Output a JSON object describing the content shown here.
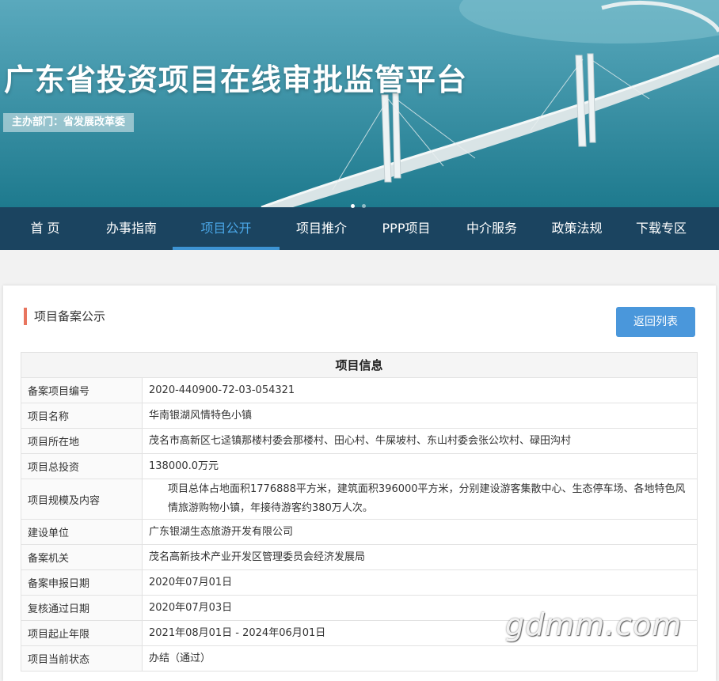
{
  "header": {
    "site_title": "广东省投资项目在线审批监管平台",
    "sponsor": "主办部门：省发展改革委"
  },
  "nav": {
    "items": [
      {
        "label": "首 页",
        "active": false
      },
      {
        "label": "办事指南",
        "active": false
      },
      {
        "label": "项目公开",
        "active": true
      },
      {
        "label": "项目推介",
        "active": false
      },
      {
        "label": "PPP项目",
        "active": false
      },
      {
        "label": "中介服务",
        "active": false
      },
      {
        "label": "政策法规",
        "active": false
      },
      {
        "label": "下载专区",
        "active": false
      }
    ]
  },
  "panel": {
    "heading": "项目备案公示",
    "back_button": "返回列表",
    "table_title": "项目信息",
    "rows": [
      {
        "label": "备案项目编号",
        "value": "2020-440900-72-03-054321"
      },
      {
        "label": "项目名称",
        "value": "华南银湖风情特色小镇"
      },
      {
        "label": "项目所在地",
        "value": "茂名市高新区七迳镇那楼村委会那楼村、田心村、牛屎坡村、东山村委会张公坎村、碌田沟村"
      },
      {
        "label": "项目总投资",
        "value": "138000.0万元"
      },
      {
        "label": "项目规模及内容",
        "value": "项目总体占地面积1776888平方米，建筑面积396000平方米，分别建设游客集散中心、生态停车场、各地特色风情旅游购物小镇，年接待游客约380万人次。"
      },
      {
        "label": "建设单位",
        "value": "广东银湖生态旅游开发有限公司"
      },
      {
        "label": "备案机关",
        "value": "茂名高新技术产业开发区管理委员会经济发展局"
      },
      {
        "label": "备案申报日期",
        "value": "2020年07月01日"
      },
      {
        "label": "复核通过日期",
        "value": "2020年07月03日"
      },
      {
        "label": "项目起止年限",
        "value": "2021年08月01日 - 2024年06月01日"
      },
      {
        "label": "项目当前状态",
        "value": "办结（通过）"
      }
    ]
  },
  "watermark": "gdmm.com",
  "colors": {
    "nav_bg": "#123c5a",
    "nav_active": "#4aa6e6",
    "accent_bar": "#e8755f",
    "button": "#4a97db"
  }
}
